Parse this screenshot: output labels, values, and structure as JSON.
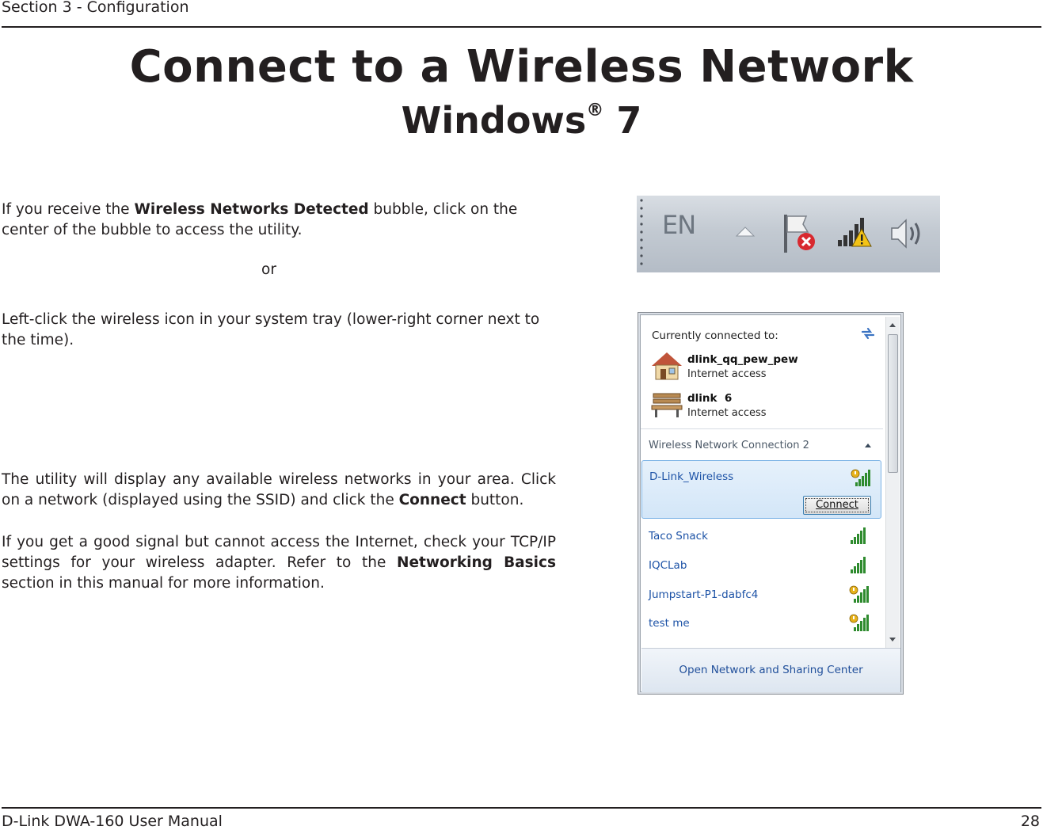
{
  "header": {
    "section": "Section 3 - Configuration"
  },
  "title": "Connect to a Wireless Network",
  "subtitle": {
    "text": "Windows",
    "mark": "®",
    "version": " 7"
  },
  "paragraphs": {
    "p1": {
      "before": "If you receive the ",
      "bold": "Wireless Networks Detected",
      "after": " bubble, click on the center of the bubble to access the utility."
    },
    "or": "or",
    "p2": "Left-click the wireless icon in your system tray (lower-right corner next to the time).",
    "p3": {
      "before": "The utility will display any available wireless networks in your area. Click on a network (displayed using the SSID) and click the ",
      "bold": "Connect",
      "after": " button."
    },
    "p4": {
      "before": "If you get a good signal but cannot access the Internet, check your TCP/IP settings for your wireless adapter. Refer to the ",
      "bold": "Networking Basics",
      "after": " section in this manual for more information."
    }
  },
  "taskbar": {
    "language": "EN",
    "icons": [
      "show-hidden-icons-arrow",
      "action-center-flag-icon",
      "wireless-signal-warning-icon",
      "speaker-volume-icon"
    ]
  },
  "popup": {
    "currently_connected": "Currently connected to:",
    "connections": [
      {
        "name": "dlink_qq_pew_pew",
        "status": "Internet access",
        "icon": "home-network-icon"
      },
      {
        "name": "dlink  6",
        "status": "Internet access",
        "icon": "park-bench-public-network-icon"
      }
    ],
    "group_label": "Wireless Network Connection 2",
    "selected_network": "D-Link_Wireless",
    "connect_button": "Connect",
    "networks": [
      {
        "name": "Taco Snack",
        "secured": false
      },
      {
        "name": "IQCLab",
        "secured": false
      },
      {
        "name": "Jumpstart-P1-dabfc4",
        "secured": true
      },
      {
        "name": "test me",
        "secured": true
      }
    ],
    "footer_link": "Open Network and Sharing Center"
  },
  "footer": {
    "manual": "D-Link DWA-160 User Manual",
    "page": "28"
  },
  "colors": {
    "text": "#231f20",
    "link_blue": "#1c52a6",
    "selection_border": "#7eb4e6"
  }
}
